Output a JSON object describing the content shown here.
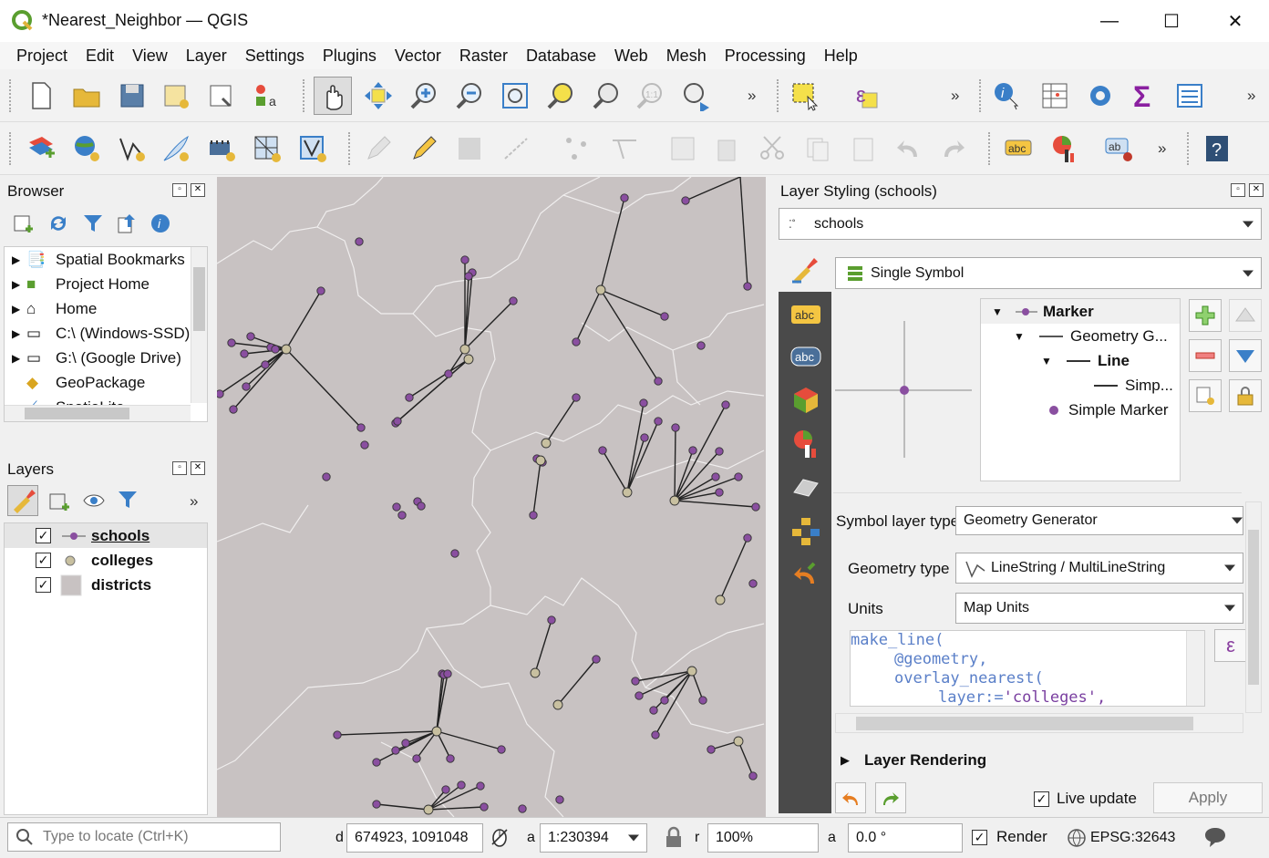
{
  "window": {
    "title": "*Nearest_Neighbor — QGIS",
    "minimize": "—",
    "maximize": "☐",
    "close": "✕"
  },
  "menu": [
    "Project",
    "Edit",
    "View",
    "Layer",
    "Settings",
    "Plugins",
    "Vector",
    "Raster",
    "Database",
    "Web",
    "Mesh",
    "Processing",
    "Help"
  ],
  "toolbar_more": "»",
  "browser": {
    "title": "Browser",
    "items": [
      "Spatial Bookmarks",
      "Project Home",
      "Home",
      "C:\\ (Windows-SSD)",
      "G:\\ (Google Drive)",
      "GeoPackage",
      "SpatiaLite"
    ]
  },
  "layers": {
    "title": "Layers",
    "items": [
      {
        "name": "schools",
        "checked": "✓"
      },
      {
        "name": "colleges",
        "checked": "✓"
      },
      {
        "name": "districts",
        "checked": "✓"
      }
    ]
  },
  "styling": {
    "title": "Layer Styling (schools)",
    "layer_combo": "schools",
    "renderer": "Single Symbol",
    "tree": {
      "marker": "Marker",
      "geomgen": "Geometry G...",
      "line": "Line",
      "simp": "Simp...",
      "simple_marker": "Simple Marker"
    },
    "symbol_layer_type_label": "Symbol layer type",
    "symbol_layer_type": "Geometry Generator",
    "geometry_type_label": "Geometry type",
    "geometry_type": "LineString / MultiLineString",
    "units_label": "Units",
    "units": "Map Units",
    "expr": {
      "l1": "make_line(",
      "l2": "@geometry,",
      "l3": "overlay_nearest(",
      "l4a": "layer:=",
      "l4b": "'colleges',"
    },
    "expr_button": "ε",
    "layer_rendering": "Layer Rendering",
    "live_update": "Live update",
    "apply": "Apply"
  },
  "status": {
    "locate_placeholder": "Type to locate (Ctrl+K)",
    "coord_label": "d",
    "coordinate": "674923, 1091048",
    "scale_label": "a",
    "scale": "1:230394",
    "mag_label": "r",
    "magnifier": "100%",
    "rot_label": "a",
    "rotation": "0.0 °",
    "render": "Render",
    "crs": "EPSG:32643"
  },
  "colors": {
    "map_bg": "#c8c2c2",
    "school": "#8a4fa0",
    "college": "#c8c0a0",
    "dark_panel": "#4a4a4a"
  }
}
